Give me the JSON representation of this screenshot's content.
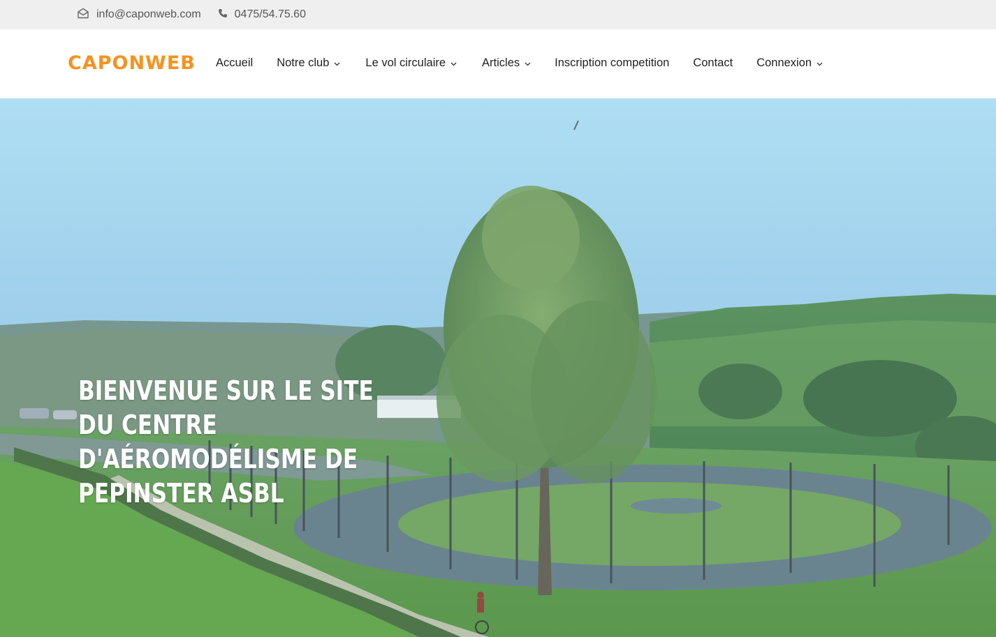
{
  "topbar": {
    "email": "info@caponweb.com",
    "phone": "0475/54.75.60",
    "email_icon": "envelope-open-icon",
    "phone_icon": "phone-icon"
  },
  "header": {
    "logo_text": "CAPONWEB",
    "logo_color": "#f5931e"
  },
  "nav": {
    "items": [
      {
        "label": "Accueil",
        "has_dropdown": false
      },
      {
        "label": "Notre club",
        "has_dropdown": true
      },
      {
        "label": "Le vol circulaire",
        "has_dropdown": true
      },
      {
        "label": "Articles",
        "has_dropdown": true
      },
      {
        "label": "Inscription competition",
        "has_dropdown": false
      },
      {
        "label": "Contact",
        "has_dropdown": false
      },
      {
        "label": "Connexion",
        "has_dropdown": true
      }
    ]
  },
  "hero": {
    "title": "Bienvenue sur le site du centre d'aéromodélisme de Pepinster ASBL"
  }
}
